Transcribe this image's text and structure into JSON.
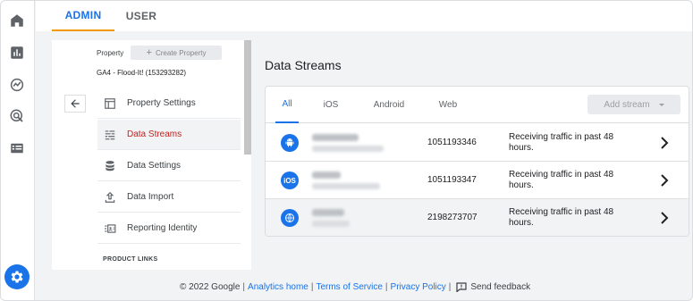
{
  "top_tabs": {
    "admin": "ADMIN",
    "user": "USER"
  },
  "rail": {
    "icons": [
      "home-icon",
      "reports-icon",
      "explore-icon",
      "advertising-icon",
      "configure-icon"
    ],
    "settings_icon": "gear-icon"
  },
  "admin_panel": {
    "property_label": "Property",
    "create_property": "Create Property",
    "property_name": "GA4 - Flood-It! (153293282)",
    "nav_items": [
      {
        "label": "Property Settings",
        "icon": "layout-icon"
      },
      {
        "label": "Data Streams",
        "icon": "streams-icon"
      },
      {
        "label": "Data Settings",
        "icon": "database-icon"
      },
      {
        "label": "Data Import",
        "icon": "upload-icon"
      },
      {
        "label": "Reporting Identity",
        "icon": "identity-icon"
      }
    ],
    "section_title": "PRODUCT LINKS"
  },
  "main": {
    "title": "Data Streams",
    "tabs": [
      "All",
      "iOS",
      "Android",
      "Web"
    ],
    "active_tab": "All",
    "add_stream": "Add stream",
    "streams": [
      {
        "platform": "android",
        "platform_icon": "android-icon",
        "stream_id": "1051193346",
        "status": "Receiving traffic in past 48 hours."
      },
      {
        "platform": "ios",
        "platform_icon_label": "iOS",
        "stream_id": "1051193347",
        "status": "Receiving traffic in past 48 hours."
      },
      {
        "platform": "web",
        "platform_icon": "globe-icon",
        "stream_id": "2198273707",
        "status": "Receiving traffic in past 48 hours."
      }
    ]
  },
  "footer": {
    "copyright": "© 2022 Google",
    "sep": "|",
    "analytics_home": "Analytics home",
    "terms": "Terms of Service",
    "privacy": "Privacy Policy",
    "feedback": "Send feedback"
  },
  "colors": {
    "accent": "#1a73e8",
    "selected_text": "#c5221f",
    "tab_underline": "#f29900"
  }
}
